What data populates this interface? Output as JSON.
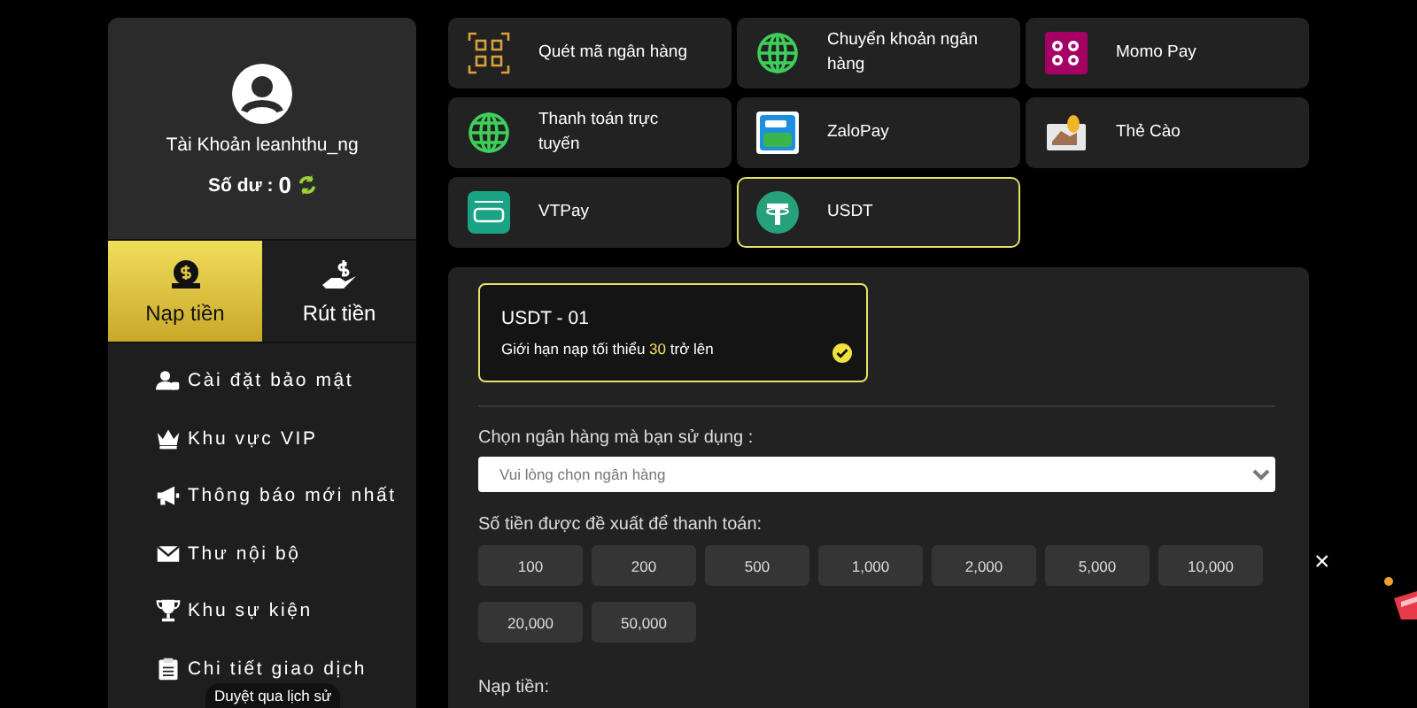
{
  "account": {
    "label": "Tài Khoản leanhthu_ng",
    "balance_label": "Số dư :",
    "balance": "0"
  },
  "actions": [
    {
      "label": "Nạp tiền",
      "kind": "deposit",
      "selected": true
    },
    {
      "label": "Rút tiền",
      "kind": "withdraw",
      "selected": false
    }
  ],
  "menu": [
    {
      "label": "Cài đặt bảo mật",
      "kind": "security"
    },
    {
      "label": "Khu vực VIP",
      "kind": "vip"
    },
    {
      "label": "Thông báo mới nhất",
      "kind": "news"
    },
    {
      "label": "Thư nội bộ",
      "kind": "mail"
    },
    {
      "label": "Khu sự kiện",
      "kind": "events"
    },
    {
      "label": "Chi tiết giao dịch",
      "kind": "transactions"
    }
  ],
  "history_tooltip": "Duyệt qua lịch sử",
  "methods": [
    {
      "label": "Quét mã ngân hàng",
      "kind": "qr",
      "selected": false
    },
    {
      "label": "Chuyển khoản ngân hàng",
      "kind": "bank",
      "selected": false
    },
    {
      "label": "Momo Pay",
      "kind": "momo",
      "selected": false
    },
    {
      "label": "Thanh toán trực tuyến",
      "kind": "bank",
      "selected": false
    },
    {
      "label": "ZaloPay",
      "kind": "zalo",
      "selected": false
    },
    {
      "label": "Thẻ Cào",
      "kind": "card",
      "selected": false
    },
    {
      "label": "VTPay",
      "kind": "vtpay",
      "selected": false
    },
    {
      "label": "USDT",
      "kind": "usdt",
      "selected": true
    }
  ],
  "channel": {
    "title": "USDT - 01",
    "limit_before": "Giới hạn nạp tối thiểu",
    "limit_value": "30",
    "limit_after": "trở lên",
    "selected": true
  },
  "bank_label": "Chọn ngân hàng mà bạn sử dụng :",
  "bank_select": {
    "placeholder": "Vui lòng chọn ngân hàng"
  },
  "amount_label": "Số tiền được đề xuất để thanh toán:",
  "amounts": [
    "100",
    "200",
    "500",
    "1,000",
    "2,000",
    "5,000",
    "10,000",
    "20,000",
    "50,000"
  ],
  "deposit_label": "Nạp tiền:",
  "close_symbol": "×"
}
